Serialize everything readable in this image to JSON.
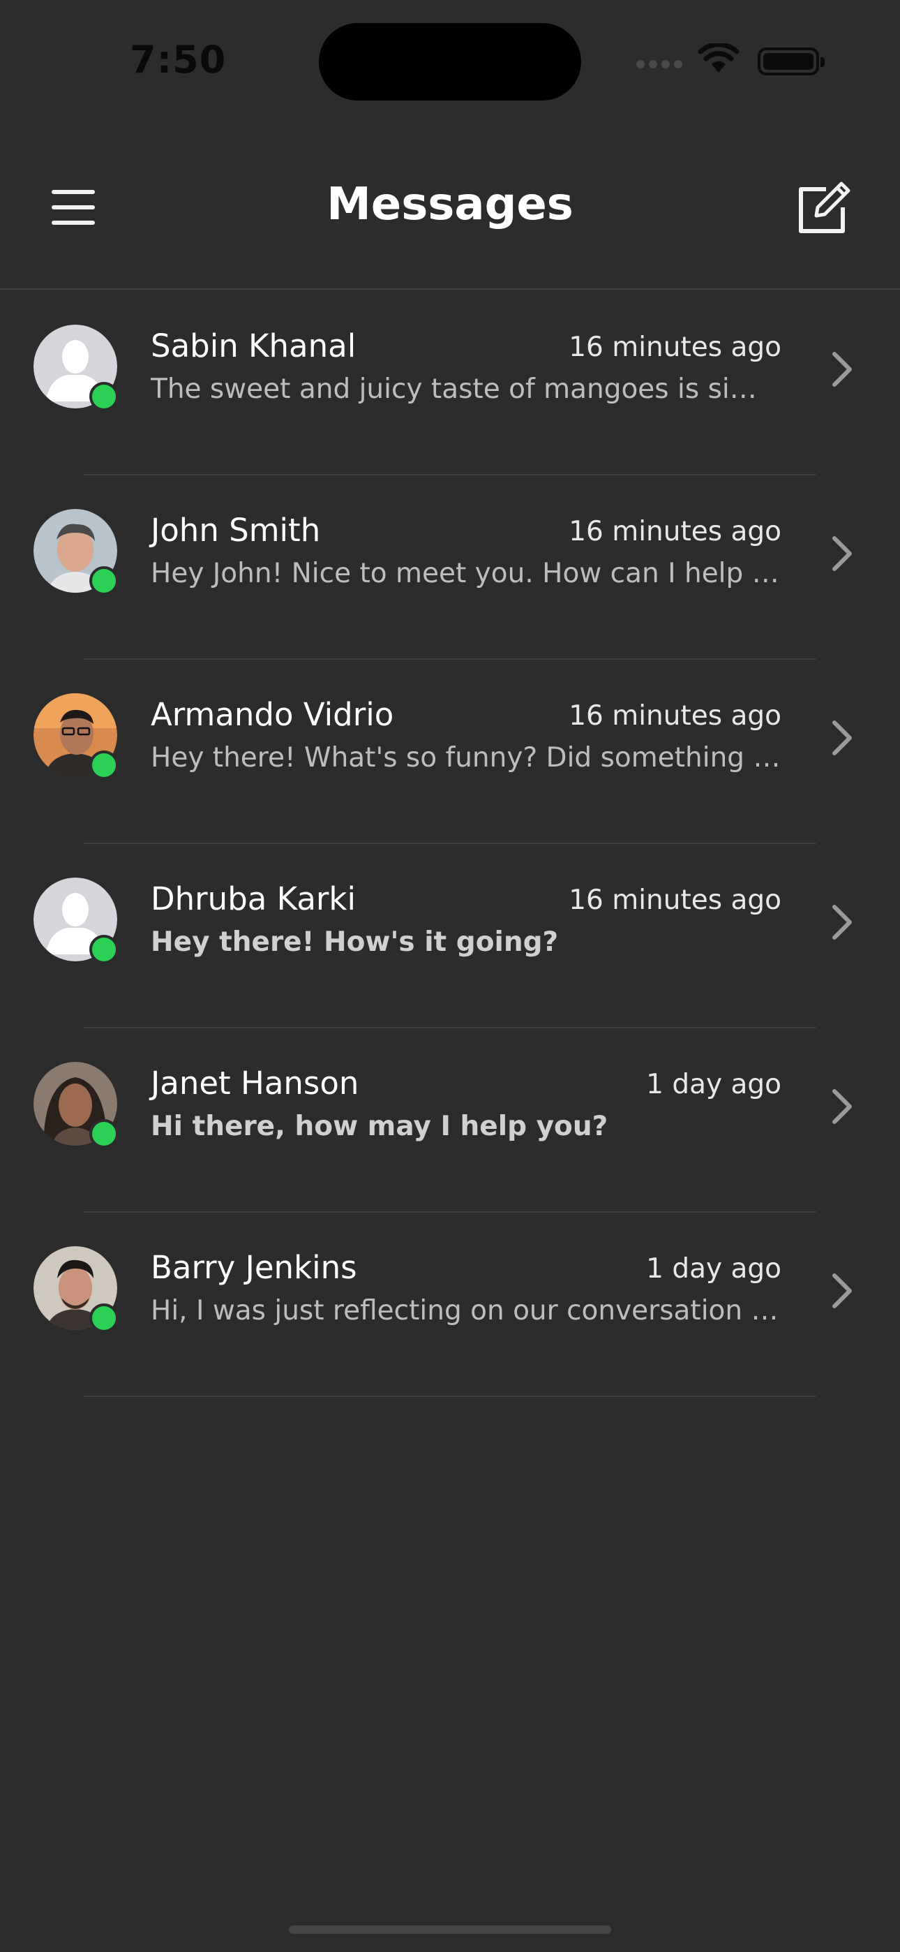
{
  "status_bar": {
    "time": "7:50"
  },
  "header": {
    "title": "Messages"
  },
  "conversations": [
    {
      "name": "Sabin Khanal",
      "timestamp": "16 minutes ago",
      "preview": "The sweet and juicy taste of mangoes is simpl...",
      "unread": false,
      "avatar": "placeholder",
      "online": true
    },
    {
      "name": "John Smith",
      "timestamp": "16 minutes ago",
      "preview": "Hey John! Nice to meet you. How can I help yo...",
      "unread": false,
      "avatar": "photo",
      "online": true
    },
    {
      "name": "Armando Vidrio",
      "timestamp": "16 minutes ago",
      "preview": "Hey there! What's so funny? Did something a...",
      "unread": false,
      "avatar": "photo",
      "online": true
    },
    {
      "name": "Dhruba Karki",
      "timestamp": "16 minutes ago",
      "preview": "Hey there! How's it going?",
      "unread": true,
      "avatar": "placeholder",
      "online": true
    },
    {
      "name": "Janet Hanson",
      "timestamp": "1 day ago",
      "preview": "Hi there, how may I help you?",
      "unread": true,
      "avatar": "photo",
      "online": true
    },
    {
      "name": "Barry Jenkins",
      "timestamp": "1 day ago",
      "preview": "Hi, I was just reflecting on our conversation an...",
      "unread": false,
      "avatar": "photo",
      "online": true
    }
  ],
  "colors": {
    "background": "#2c2c2c",
    "online": "#2bcf55",
    "divider": "#3e3e3e"
  },
  "icons": {
    "menu": "hamburger-icon",
    "compose": "compose-icon",
    "row_action": "chevron-right-icon"
  }
}
